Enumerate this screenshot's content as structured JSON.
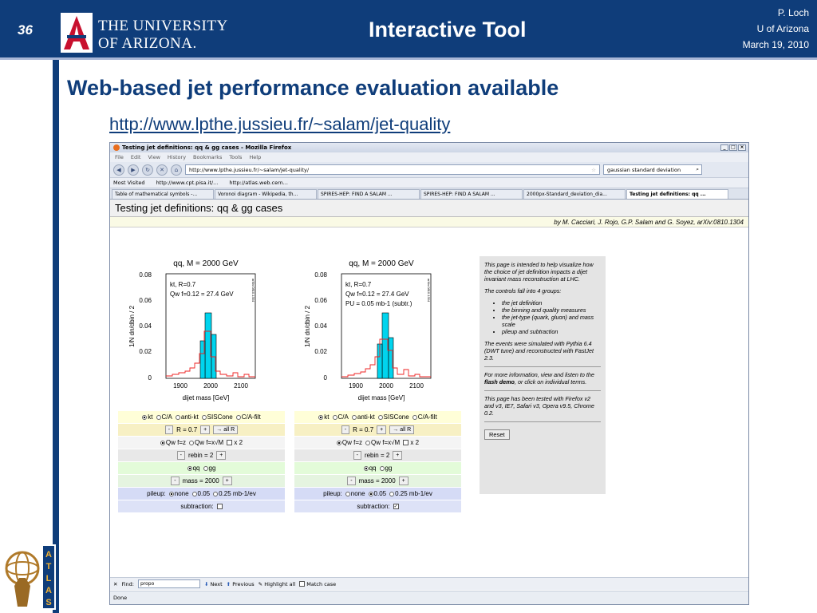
{
  "slide": {
    "number": "36",
    "university_line1": "THE UNIVERSITY",
    "university_line2": "OF ARIZONA.",
    "title": "Interactive Tool",
    "author": "P. Loch",
    "affiliation": "U of Arizona",
    "date": "March 19, 2010",
    "headline": "Web-based jet performance evaluation available",
    "url": "http://www.lpthe.jussieu.fr/~salam/jet-quality",
    "atlas_letters": [
      "A",
      "T",
      "L",
      "A",
      "S"
    ]
  },
  "colors": {
    "brand": "#0f3d7a",
    "cyan_bar": "#00d4ee",
    "red_line": "#ee2222"
  },
  "browser": {
    "window_title": "Testing jet definitions: qq & gg cases - Mozilla Firefox",
    "menu": [
      "File",
      "Edit",
      "View",
      "History",
      "Bookmarks",
      "Tools",
      "Help"
    ],
    "address": "http://www.lpthe.jussieu.fr/~salam/jet-quality/",
    "search": "gaussian standard deviation",
    "bookmarks": [
      "Most Visited",
      "http://www.cpt.pisa.it/...",
      "http://atlas.web.cern..."
    ],
    "tabs": [
      "Table of mathematical symbols -...",
      "Voronoi diagram - Wikipedia, th...",
      "SPIRES-HEP: FIND A SALAM ...",
      "SPIRES-HEP: FIND A SALAM ...",
      "2000px-Standard_deviation_dia...",
      "Testing jet definitions: qq ..."
    ],
    "page_title": "Testing jet definitions: qq & gg cases",
    "credit": "by M. Cacciari, J. Rojo, G.P. Salam and G. Soyez, arXiv:0810.1304",
    "find_label": "Find:",
    "find_value": "propo",
    "find_next": "Next",
    "find_previous": "Previous",
    "find_highlight": "Highlight all",
    "find_match": "Match case",
    "status": "Done"
  },
  "plots": [
    {
      "title": "qq, M = 2000 GeV",
      "label1": "kt, R=0.7",
      "label2": "Qw f=0.12 = 27.4 GeV",
      "label3": "",
      "ylabel": "1/N dn/dbin / 2",
      "xlabel": "dijet mass [GeV]",
      "yticks": [
        "0.08",
        "0.06",
        "0.04",
        "0.02",
        "0"
      ],
      "xticks": [
        "1900",
        "2000",
        "2100"
      ],
      "side": "arXiv:0810.1304"
    },
    {
      "title": "qq, M = 2000 GeV",
      "label1": "kt, R=0.7",
      "label2": "Qw f=0.12 = 27.4 GeV",
      "label3": "PU = 0.05 mb-1 (subtr.)",
      "ylabel": "1/N dn/dbin / 2",
      "xlabel": "dijet mass [GeV]",
      "yticks": [
        "0.08",
        "0.06",
        "0.04",
        "0.02",
        "0"
      ],
      "xticks": [
        "1900",
        "2000",
        "2100"
      ],
      "side": "arXiv:0810.1304"
    }
  ],
  "controls": [
    {
      "algos": [
        "kt",
        "C/A",
        "anti-kt",
        "SISCone",
        "C/A-filt"
      ],
      "radius": "R = 0.7",
      "all_r": "→ all R",
      "q_opts": [
        "Qw f=z",
        "Qw f=x√M",
        "x 2"
      ],
      "rebin": "rebin = 2",
      "flavours": [
        "qq",
        "gg"
      ],
      "mass": "mass = 2000",
      "pileup_label": "pileup:",
      "pileup_opts": [
        "none",
        "0.05",
        "0.25 mb-1/ev"
      ],
      "subtraction": "subtraction:",
      "pileup_selected": 0,
      "subtraction_checked": false
    },
    {
      "algos": [
        "kt",
        "C/A",
        "anti-kt",
        "SISCone",
        "C/A-filt"
      ],
      "radius": "R = 0.7",
      "all_r": "→ all R",
      "q_opts": [
        "Qw f=z",
        "Qw f=x√M",
        "x 2"
      ],
      "rebin": "rebin = 2",
      "flavours": [
        "qq",
        "gg"
      ],
      "mass": "mass = 2000",
      "pileup_label": "pileup:",
      "pileup_opts": [
        "none",
        "0.05",
        "0.25 mb-1/ev"
      ],
      "subtraction": "subtraction:",
      "pileup_selected": 1,
      "subtraction_checked": true
    }
  ],
  "info": {
    "p1": "This page is intended to help visualize how the choice of jet definition impacts a dijet invariant mass reconstruction at LHC.",
    "p2": "The controls fall into 4 groups:",
    "groups": [
      "the jet definition",
      "the binning and quality measures",
      "the jet-type (quark, gluon) and mass scale",
      "pileup and subtraction"
    ],
    "p3": "The events were simulated with Pythia 6.4 (DWT tune) and reconstructed with FastJet 2.3.",
    "p4a": "For more information, view and listen to the ",
    "p4b": "flash demo",
    "p4c": ", or click on individual terms.",
    "p5": "This page has been tested with Firefox v2 and v3, IE7, Safari v3, Opera v9.5, Chrome 0.2.",
    "reset": "Reset"
  }
}
